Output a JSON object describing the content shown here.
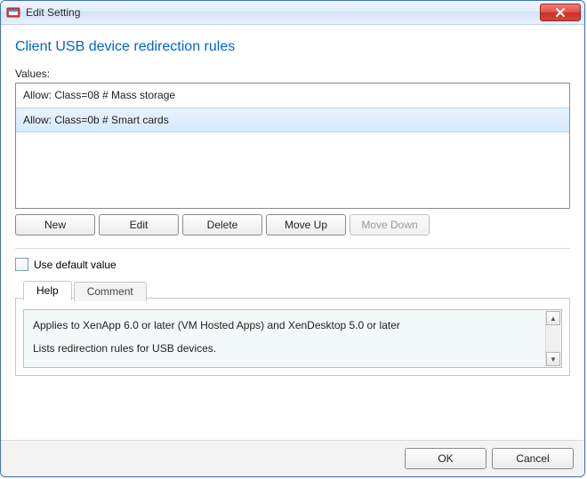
{
  "window": {
    "title": "Edit Setting"
  },
  "page": {
    "title": "Client USB device redirection rules",
    "values_label": "Values:"
  },
  "values_list": {
    "items": [
      {
        "text": "Allow: Class=08 # Mass storage",
        "selected": false
      },
      {
        "text": "Allow: Class=0b # Smart cards",
        "selected": true
      }
    ]
  },
  "buttons": {
    "new": "New",
    "edit": "Edit",
    "delete": "Delete",
    "move_up": "Move Up",
    "move_down": "Move Down",
    "move_down_enabled": false
  },
  "default_checkbox": {
    "checked": false,
    "label": "Use default value"
  },
  "tabs": {
    "help": "Help",
    "comment": "Comment",
    "active": "help"
  },
  "help": {
    "line1": "Applies to XenApp 6.0 or later (VM Hosted Apps) and XenDesktop 5.0 or later",
    "line2": "Lists redirection rules for USB devices."
  },
  "footer": {
    "ok": "OK",
    "cancel": "Cancel"
  }
}
